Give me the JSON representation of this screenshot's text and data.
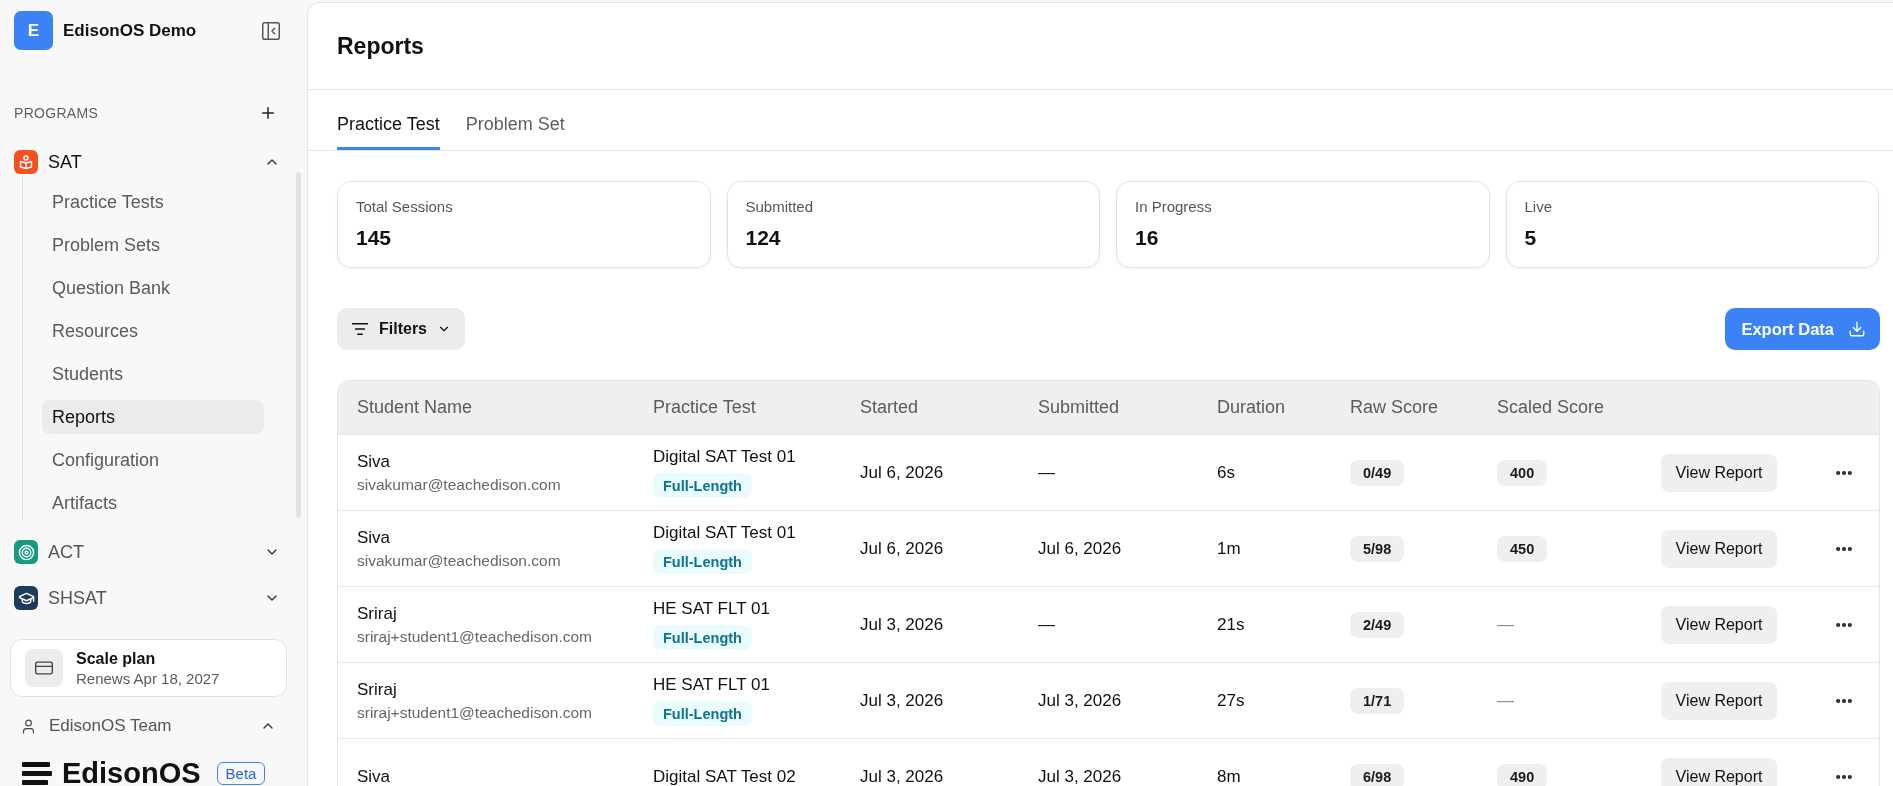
{
  "sidebar": {
    "workspace": {
      "initial": "E",
      "name": "EdisonOS Demo"
    },
    "section_label": "PROGRAMS",
    "programs": [
      {
        "name": "SAT",
        "kind": "sat",
        "expanded": true,
        "children": [
          {
            "label": "Practice Tests",
            "selected": false
          },
          {
            "label": "Problem Sets",
            "selected": false
          },
          {
            "label": "Question Bank",
            "selected": false
          },
          {
            "label": "Resources",
            "selected": false
          },
          {
            "label": "Students",
            "selected": false
          },
          {
            "label": "Reports",
            "selected": true
          },
          {
            "label": "Configuration",
            "selected": false
          },
          {
            "label": "Artifacts",
            "selected": false
          }
        ]
      },
      {
        "name": "ACT",
        "kind": "act",
        "expanded": false
      },
      {
        "name": "SHSAT",
        "kind": "shsat",
        "expanded": false
      }
    ],
    "plan": {
      "name": "Scale plan",
      "renewal": "Renews Apr 18, 2027"
    },
    "team": {
      "name": "EdisonOS Team",
      "expanded": true
    },
    "brand": {
      "name": "EdisonOS",
      "badge": "Beta"
    }
  },
  "page": {
    "title": "Reports"
  },
  "tabs": [
    {
      "label": "Practice Test",
      "selected": true
    },
    {
      "label": "Problem Set",
      "selected": false
    }
  ],
  "stats": [
    {
      "label": "Total Sessions",
      "value": "145"
    },
    {
      "label": "Submitted",
      "value": "124"
    },
    {
      "label": "In Progress",
      "value": "16"
    },
    {
      "label": "Live",
      "value": "5"
    }
  ],
  "toolbar": {
    "filters": "Filters",
    "export": "Export Data"
  },
  "table": {
    "columns": [
      "Student Name",
      "Practice Test",
      "Started",
      "Submitted",
      "Duration",
      "Raw Score",
      "Scaled Score"
    ],
    "rows": [
      {
        "name": "Siva",
        "email": "sivakumar@teachedison.com",
        "test": "Digital SAT Test 01",
        "tag": "Full-Length",
        "started": "Jul 6, 2026",
        "submitted": "—",
        "duration": "6s",
        "raw_score": "0/49",
        "scaled_score": {
          "value": "400",
          "kind": "pill"
        },
        "action": "View Report"
      },
      {
        "name": "Siva",
        "email": "sivakumar@teachedison.com",
        "test": "Digital SAT Test 01",
        "tag": "Full-Length",
        "started": "Jul 6, 2026",
        "submitted": "Jul 6, 2026",
        "duration": "1m",
        "raw_score": "5/98",
        "scaled_score": {
          "value": "450",
          "kind": "pill"
        },
        "action": "View Report"
      },
      {
        "name": "Sriraj",
        "email": "sriraj+student1@teachedison.com",
        "test": "HE SAT FLT 01",
        "tag": "Full-Length",
        "started": "Jul 3, 2026",
        "submitted": "—",
        "duration": "21s",
        "raw_score": "2/49",
        "scaled_score": {
          "value": "—",
          "kind": "plain"
        },
        "action": "View Report"
      },
      {
        "name": "Sriraj",
        "email": "sriraj+student1@teachedison.com",
        "test": "HE SAT FLT 01",
        "tag": "Full-Length",
        "started": "Jul 3, 2026",
        "submitted": "Jul 3, 2026",
        "duration": "27s",
        "raw_score": "1/71",
        "scaled_score": {
          "value": "—",
          "kind": "plain"
        },
        "action": "View Report"
      },
      {
        "name": "Siva",
        "test": "Digital SAT Test 02",
        "started": "Jul 3, 2026",
        "submitted": "Jul 3, 2026",
        "duration": "8m",
        "raw_score": "6/98",
        "scaled_score": {
          "value": "490",
          "kind": "pill"
        },
        "action": "View Report"
      }
    ]
  }
}
